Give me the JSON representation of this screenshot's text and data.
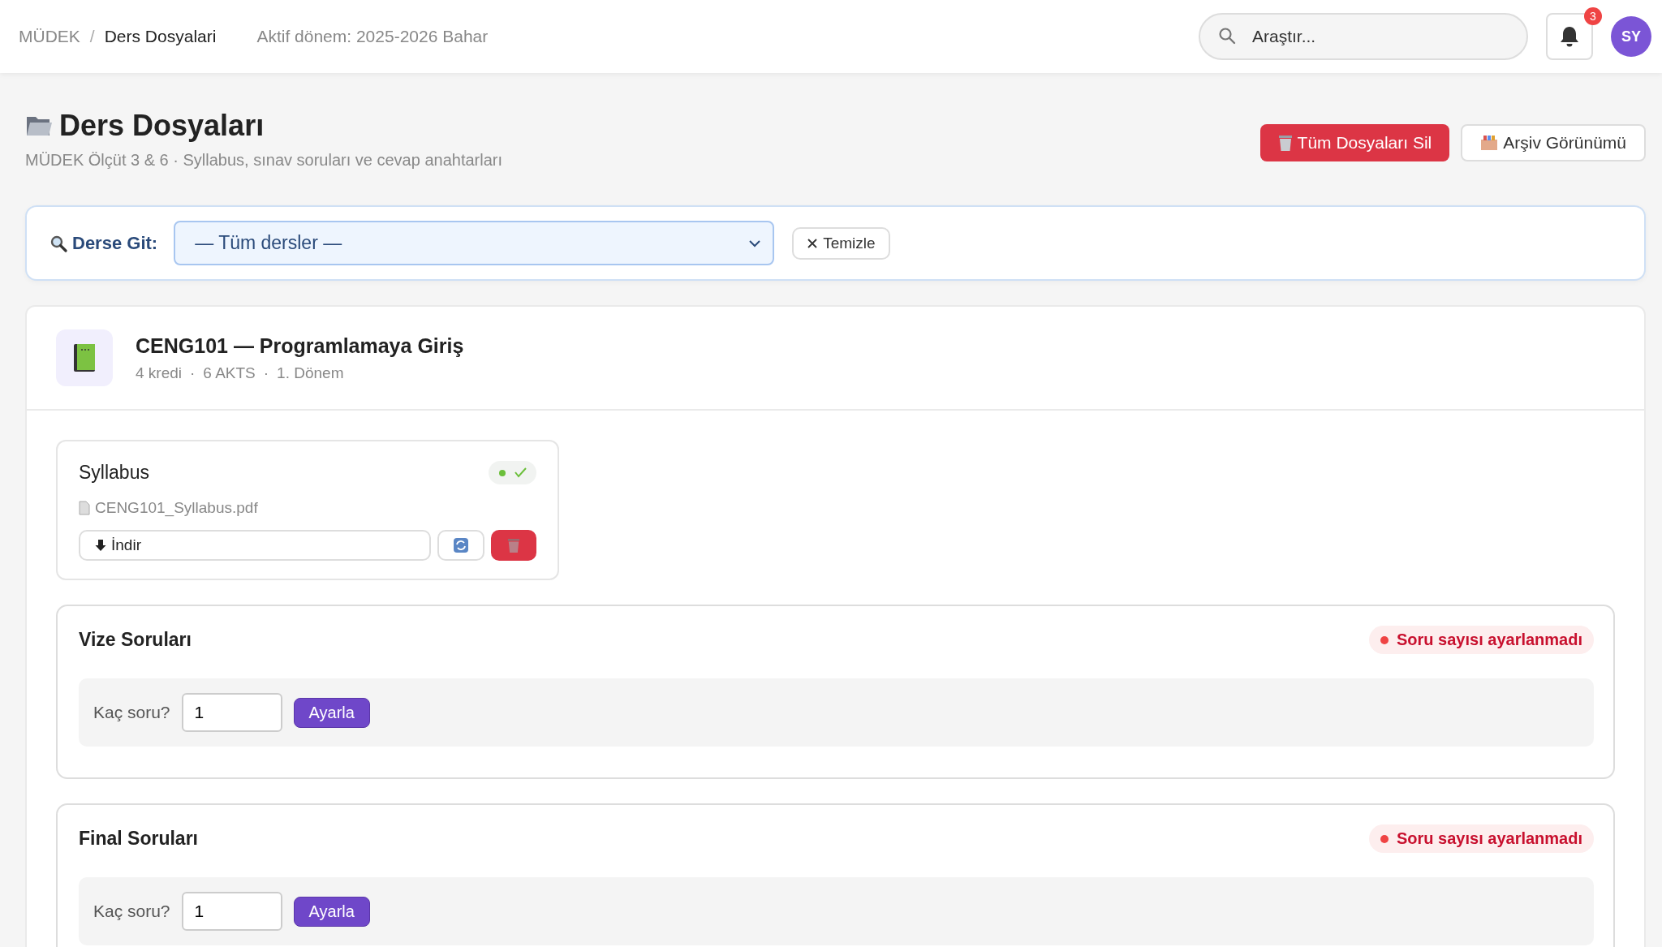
{
  "header": {
    "breadcrumb_separator": "/",
    "breadcrumb": [
      {
        "label": "MÜDEK",
        "current": false
      },
      {
        "label": "Ders Dosyalari",
        "current": true
      }
    ],
    "active_term": "Aktif dönem: 2025-2026 Bahar",
    "search": {
      "placeholder": "Araştır..."
    },
    "notifications": {
      "count": "3"
    },
    "avatar": {
      "initials": "SY"
    }
  },
  "page": {
    "title": "Ders Dosyaları",
    "subtitle": "MÜDEK Ölçüt 3 & 6 · Syllabus, sınav soruları ve cevap anahtarları",
    "actions": [
      {
        "label": "Tüm Dosyaları Sil",
        "kind": "danger"
      },
      {
        "label": "Arşiv Görünümü",
        "kind": "archive"
      }
    ]
  },
  "filter": {
    "label": "Derse Git:",
    "select": {
      "value": "— Tüm dersler —"
    },
    "clear_button": "Temizle"
  },
  "course": {
    "title": "CENG101 — Programlamaya Giriş",
    "meta_separator": "·",
    "meta": [
      "4 kredi",
      "6 AKTS",
      "1. Dönem"
    ],
    "syllabus": {
      "title": "Syllabus",
      "uploaded": true,
      "file": "CENG101_Syllabus.pdf",
      "download_button": "İndir"
    },
    "sections": [
      {
        "title": "Vize Soruları",
        "status": "Soru sayısı ayarlanmadı",
        "prompt": "Kaç soru?",
        "count": "1",
        "button": "Ayarla"
      },
      {
        "title": "Final Soruları",
        "status": "Soru sayısı ayarlanmadı",
        "prompt": "Kaç soru?",
        "count": "1",
        "button": "Ayarla"
      }
    ]
  }
}
